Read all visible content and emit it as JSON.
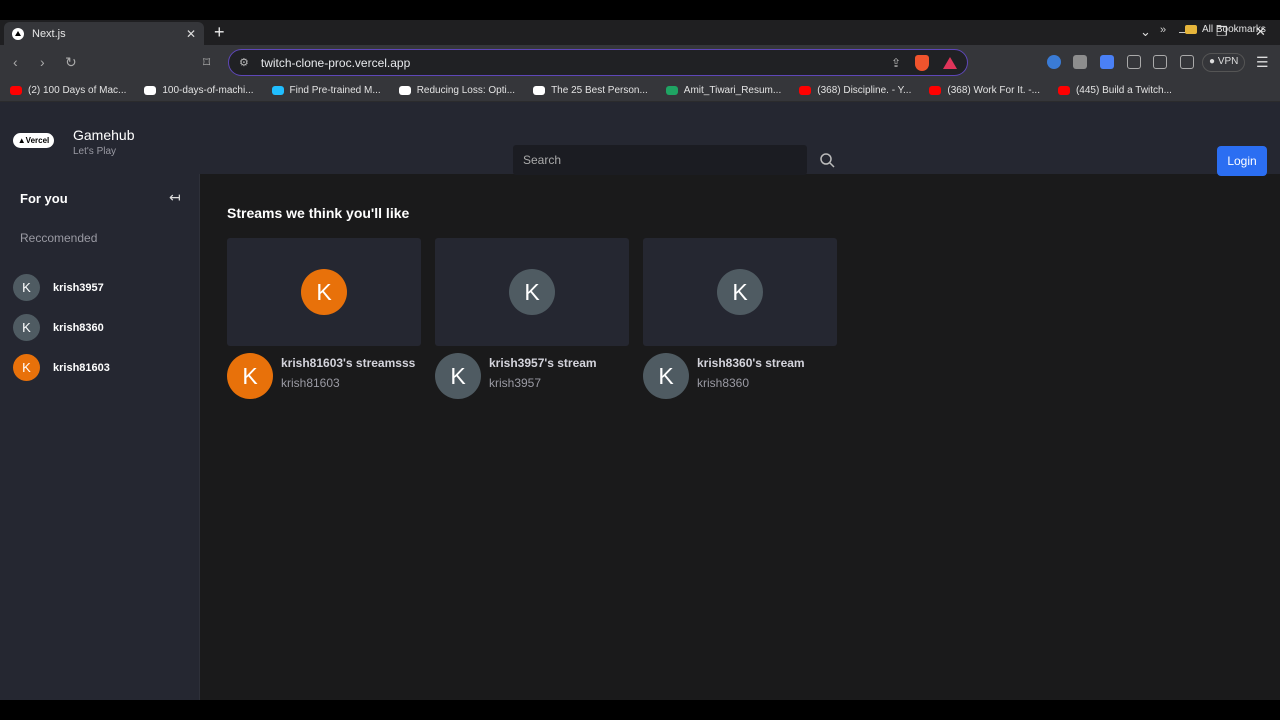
{
  "browser": {
    "tab_title": "Next.js",
    "tab_close": "✕",
    "new_tab": "+",
    "url": "twitch-clone-proc.vercel.app",
    "vpn_label": "VPN",
    "bookmarks": [
      {
        "label": "(2) 100 Days of Mac...",
        "icon": "youtube-icon",
        "color": "#ff0000"
      },
      {
        "label": "100-days-of-machi...",
        "icon": "github-icon",
        "color": "#ffffff"
      },
      {
        "label": "Find Pre-trained M...",
        "icon": "kaggle-icon",
        "color": "#20beff"
      },
      {
        "label": "Reducing Loss: Opti...",
        "icon": "google-icon",
        "color": "#ffffff"
      },
      {
        "label": "The 25 Best Person...",
        "icon": "medium-icon",
        "color": "#ffffff"
      },
      {
        "label": "Amit_Tiwari_Resum...",
        "icon": "drive-icon",
        "color": "#1fa463"
      },
      {
        "label": "(368) Discipline. - Y...",
        "icon": "youtube-icon",
        "color": "#ff0000"
      },
      {
        "label": "(368) Work For It. -...",
        "icon": "youtube-icon",
        "color": "#ff0000"
      },
      {
        "label": "(445) Build a Twitch...",
        "icon": "youtube-icon",
        "color": "#ff0000"
      }
    ],
    "bookmarks_more": "»",
    "all_bookmarks": "All Bookmarks"
  },
  "header": {
    "logo": "▲Vercel",
    "title": "Gamehub",
    "subtitle": "Let's Play",
    "search_placeholder": "Search",
    "login_label": "Login"
  },
  "sidebar": {
    "heading": "For you",
    "collapse_icon": "↤",
    "section": "Reccomended",
    "items": [
      {
        "initial": "K",
        "name": "krish3957",
        "color": "#4f5b62"
      },
      {
        "initial": "K",
        "name": "krish8360",
        "color": "#4f5b62"
      },
      {
        "initial": "K",
        "name": "krish81603",
        "color": "#e8710a"
      }
    ]
  },
  "main": {
    "title": "Streams we think you'll like",
    "streams": [
      {
        "initial": "K",
        "title": "krish81603's streamsss",
        "user": "krish81603",
        "color": "#e8710a"
      },
      {
        "initial": "K",
        "title": "krish3957's stream",
        "user": "krish3957",
        "color": "#4f5b62"
      },
      {
        "initial": "K",
        "title": "krish8360's stream",
        "user": "krish8360",
        "color": "#4f5b62"
      }
    ]
  }
}
